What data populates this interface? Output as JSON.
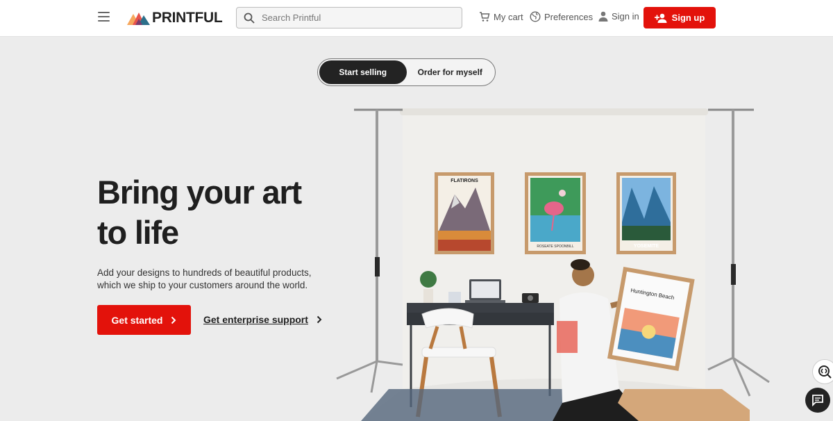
{
  "header": {
    "logo_text": "PRINTFUL",
    "search_placeholder": "Search Printful",
    "cart_label": "My cart",
    "preferences_label": "Preferences",
    "signin_label": "Sign in",
    "signup_label": "Sign up"
  },
  "toggle": {
    "options": [
      "Start selling",
      "Order for myself"
    ],
    "selected": "Start selling"
  },
  "hero": {
    "headline_line1": "Bring your art",
    "headline_line2": "to life",
    "subtext": "Add your designs to hundreds of beautiful products, which we ship to your customers around the world.",
    "cta_primary": "Get started",
    "cta_secondary": "Get enterprise support"
  },
  "scene": {
    "poster1_title": "FLATIRONS",
    "poster2_title": "ROSEATE SPOONBILL",
    "poster3_title": "YOSEMITE",
    "held_poster_title": "Huntington Beach"
  },
  "colors": {
    "brand_red": "#e3120b",
    "toggle_dark": "#232323"
  }
}
